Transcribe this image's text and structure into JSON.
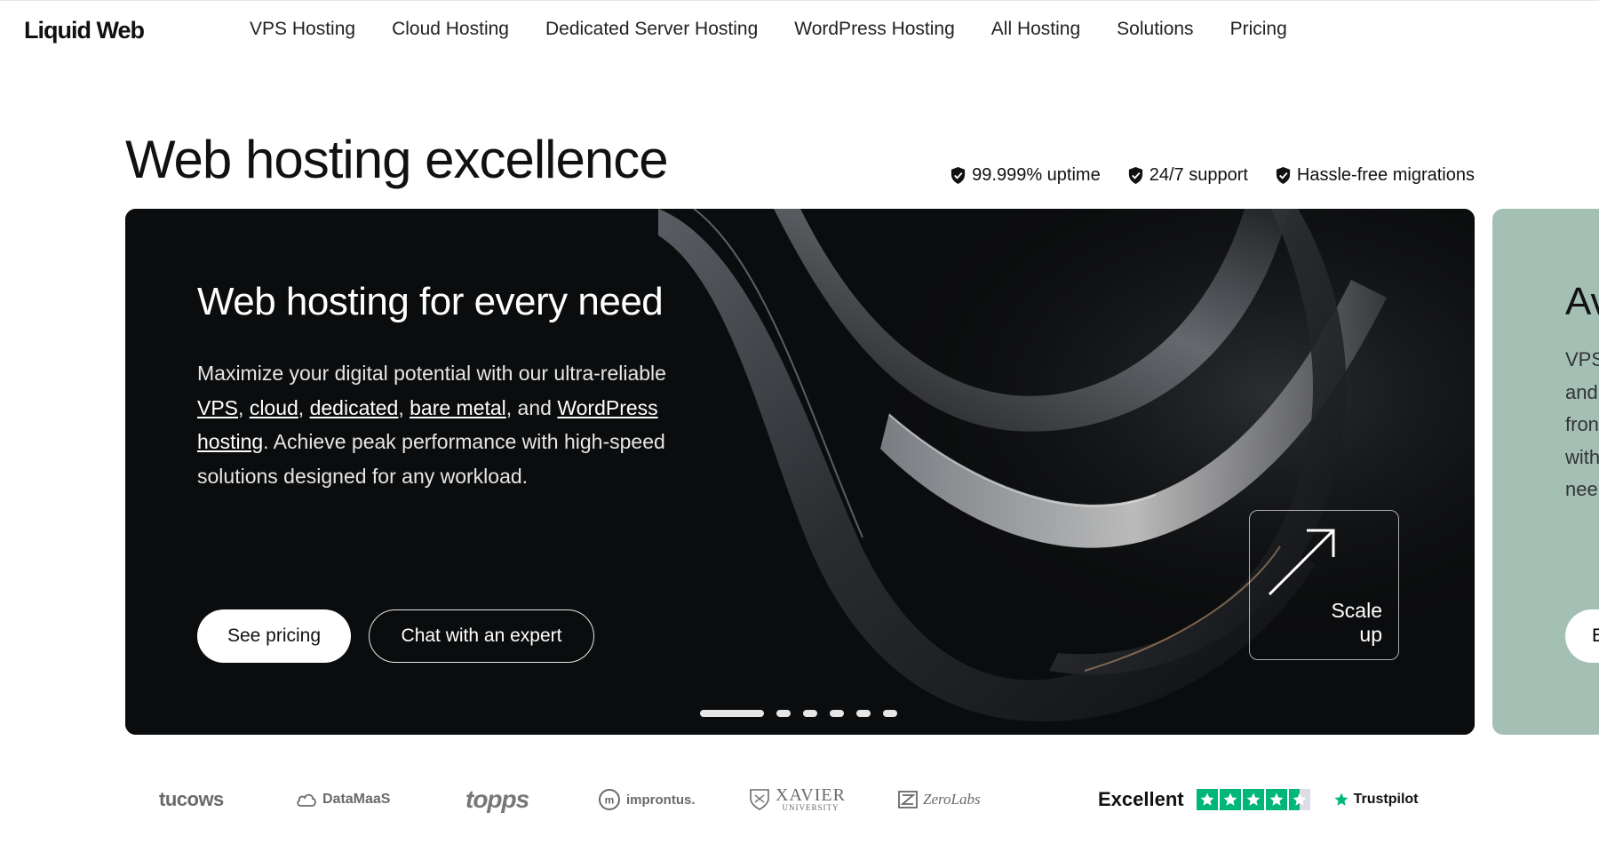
{
  "brand": {
    "logo_text": "Liquid Web"
  },
  "nav": {
    "items": [
      {
        "label": "VPS Hosting"
      },
      {
        "label": "Cloud Hosting"
      },
      {
        "label": "Dedicated Server Hosting"
      },
      {
        "label": "WordPress Hosting"
      },
      {
        "label": "All Hosting"
      },
      {
        "label": "Solutions"
      },
      {
        "label": "Pricing"
      }
    ]
  },
  "hero": {
    "page_title": "Web hosting excellence",
    "features": [
      {
        "icon": "shield-check-icon",
        "label": "99.999% uptime"
      },
      {
        "icon": "shield-check-icon",
        "label": "24/7 support"
      },
      {
        "icon": "shield-check-icon",
        "label": "Hassle-free migrations"
      }
    ],
    "card": {
      "title": "Web hosting for every need",
      "desc_intro": "Maximize your digital potential with our ultra-reliable ",
      "links": {
        "vps": "VPS",
        "cloud": "cloud",
        "dedicated": "dedicated",
        "bare_metal": "bare metal",
        "wordpress": "WordPress hosting"
      },
      "sep1": ", ",
      "sep2": ", ",
      "sep3": ", ",
      "sep4": ", and ",
      "desc_outro": ". Achieve peak performance with high-speed solutions designed for any workload.",
      "primary_button": "See pricing",
      "secondary_button": "Chat with an expert",
      "badge_label_line1": "Scale",
      "badge_label_line2": "up",
      "carousel": {
        "slide_count": 6,
        "active_index": 0
      }
    },
    "next_card": {
      "title_partial": "Av",
      "desc_lines": [
        "VPS",
        "and",
        "fron",
        "with",
        "nee"
      ],
      "button_partial": "E",
      "background": "#a4c0b5"
    }
  },
  "clients": {
    "logos": [
      {
        "name": "tucows"
      },
      {
        "name": "DataMaaS"
      },
      {
        "name": "topps"
      },
      {
        "name": "improntus."
      },
      {
        "name": "XAVIER",
        "sub": "UNIVERSITY"
      },
      {
        "name": "ZeroLabs"
      }
    ]
  },
  "trustpilot": {
    "rating_word": "Excellent",
    "stars": 4.5,
    "brand": "Trustpilot",
    "color": "#00b67a"
  }
}
